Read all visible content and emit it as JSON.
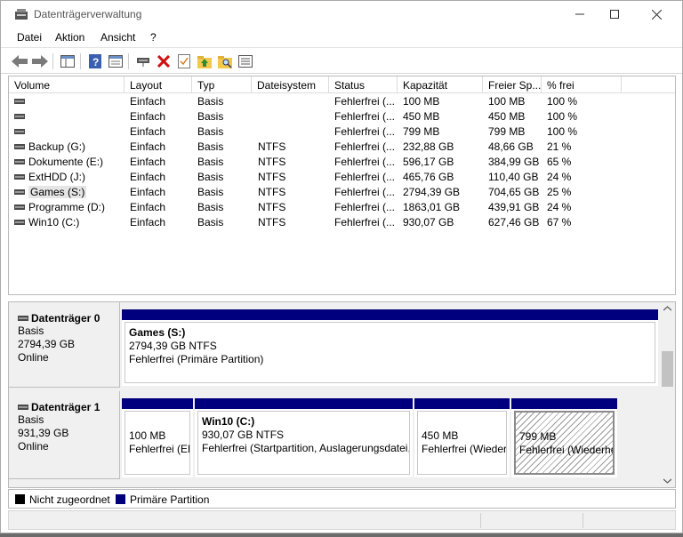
{
  "window": {
    "title": "Datenträgerverwaltung"
  },
  "menu": [
    "Datei",
    "Aktion",
    "Ansicht",
    "?"
  ],
  "toolbar": [
    "back-icon",
    "forward-icon",
    "console-tree-icon",
    "help-icon",
    "properties-icon",
    "connect-icon",
    "delete-icon",
    "check-icon",
    "folder-up-icon",
    "folder-search-icon",
    "list-icon"
  ],
  "columns": [
    "Volume",
    "Layout",
    "Typ",
    "Dateisystem",
    "Status",
    "Kapazität",
    "Freier Sp...",
    "% frei"
  ],
  "volumes": [
    {
      "name": "",
      "layout": "Einfach",
      "type": "Basis",
      "fs": "",
      "status": "Fehlerfrei (...",
      "capacity": "100 MB",
      "free": "100 MB",
      "pct": "100 %"
    },
    {
      "name": "",
      "layout": "Einfach",
      "type": "Basis",
      "fs": "",
      "status": "Fehlerfrei (...",
      "capacity": "450 MB",
      "free": "450 MB",
      "pct": "100 %"
    },
    {
      "name": "",
      "layout": "Einfach",
      "type": "Basis",
      "fs": "",
      "status": "Fehlerfrei (...",
      "capacity": "799 MB",
      "free": "799 MB",
      "pct": "100 %"
    },
    {
      "name": "Backup (G:)",
      "layout": "Einfach",
      "type": "Basis",
      "fs": "NTFS",
      "status": "Fehlerfrei (...",
      "capacity": "232,88 GB",
      "free": "48,66 GB",
      "pct": "21 %"
    },
    {
      "name": "Dokumente (E:)",
      "layout": "Einfach",
      "type": "Basis",
      "fs": "NTFS",
      "status": "Fehlerfrei (...",
      "capacity": "596,17 GB",
      "free": "384,99 GB",
      "pct": "65 %"
    },
    {
      "name": "ExtHDD (J:)",
      "layout": "Einfach",
      "type": "Basis",
      "fs": "NTFS",
      "status": "Fehlerfrei (...",
      "capacity": "465,76 GB",
      "free": "110,40 GB",
      "pct": "24 %"
    },
    {
      "name": "Games (S:)",
      "layout": "Einfach",
      "type": "Basis",
      "fs": "NTFS",
      "status": "Fehlerfrei (...",
      "capacity": "2794,39 GB",
      "free": "704,65 GB",
      "pct": "25 %"
    },
    {
      "name": "Programme (D:)",
      "layout": "Einfach",
      "type": "Basis",
      "fs": "NTFS",
      "status": "Fehlerfrei (...",
      "capacity": "1863,01 GB",
      "free": "439,91 GB",
      "pct": "24 %"
    },
    {
      "name": "Win10 (C:)",
      "layout": "Einfach",
      "type": "Basis",
      "fs": "NTFS",
      "status": "Fehlerfrei (...",
      "capacity": "930,07 GB",
      "free": "627,46 GB",
      "pct": "67 %"
    }
  ],
  "disks": [
    {
      "name": "Datenträger 0",
      "type": "Basis",
      "size": "2794,39 GB",
      "state": "Online",
      "partitions": [
        {
          "title": "Games  (S:)",
          "line1": "2794,39 GB NTFS",
          "line2": "Fehlerfrei (Primäre Partition)"
        }
      ]
    },
    {
      "name": "Datenträger 1",
      "type": "Basis",
      "size": "931,39 GB",
      "state": "Online",
      "partitions": [
        {
          "title": "",
          "line1": "100 MB",
          "line2": "Fehlerfrei (EF"
        },
        {
          "title": "Win10  (C:)",
          "line1": "930,07 GB NTFS",
          "line2": "Fehlerfrei (Startpartition, Auslagerungsdatei,"
        },
        {
          "title": "",
          "line1": "450 MB",
          "line2": "Fehlerfrei (Wieder"
        },
        {
          "title": "",
          "line1": "799 MB",
          "line2": "Fehlerfrei (Wiederhe"
        }
      ]
    }
  ],
  "legend": [
    {
      "label": "Nicht zugeordnet",
      "color": "#000000"
    },
    {
      "label": "Primäre Partition",
      "color": "#00007f"
    }
  ],
  "colors": {
    "partition_bar": "#00007f",
    "selection": "#cde8ff"
  }
}
